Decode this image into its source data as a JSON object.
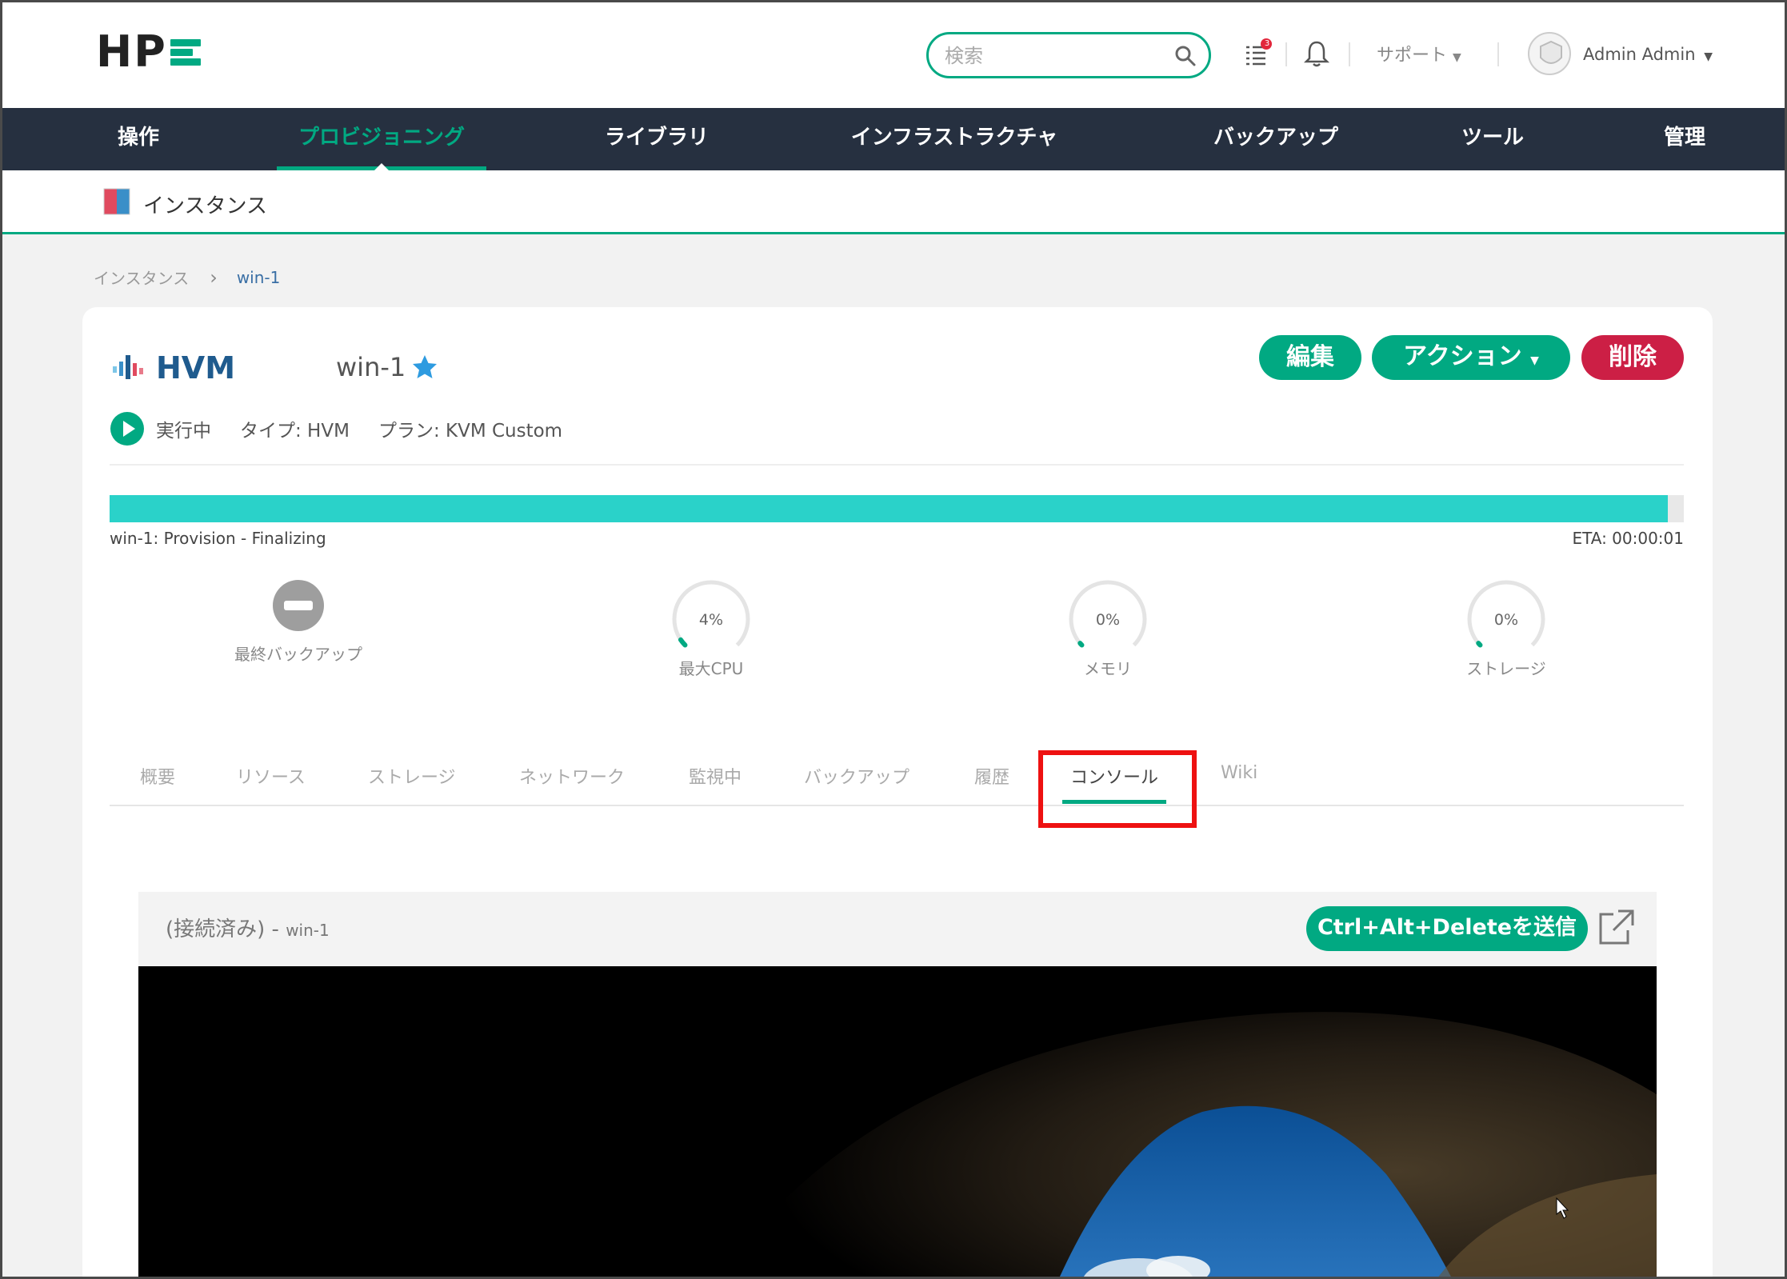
{
  "header": {
    "logo_text": "HP",
    "search_placeholder": "検索",
    "notification_count": "3",
    "support_label": "サポート",
    "user_name": "Admin Admin"
  },
  "nav": {
    "items": [
      {
        "label": "操作"
      },
      {
        "label": "プロビジョニング"
      },
      {
        "label": "ライブラリ"
      },
      {
        "label": "インフラストラクチャ"
      },
      {
        "label": "バックアップ"
      },
      {
        "label": "ツール"
      },
      {
        "label": "管理"
      }
    ],
    "active_index": 1
  },
  "subheader": {
    "title": "インスタンス"
  },
  "breadcrumb": {
    "parent": "インスタンス",
    "current": "win-1"
  },
  "instance": {
    "cloud_logo_text": "HVM",
    "name": "win-1",
    "status_label": "実行中",
    "type_label": "タイプ: HVM",
    "plan_label": "プラン: KVM Custom",
    "buttons": {
      "edit": "編集",
      "actions": "アクション",
      "delete": "削除"
    }
  },
  "progress": {
    "label": "win-1: Provision - Finalizing",
    "eta": "ETA: 00:00:01",
    "fraction": 0.99
  },
  "stats": [
    {
      "label": "最終バックアップ",
      "kind": "none"
    },
    {
      "label": "最大CPU",
      "value_text": "4%",
      "value": 4
    },
    {
      "label": "メモリ",
      "value_text": "0%",
      "value": 0
    },
    {
      "label": "ストレージ",
      "value_text": "0%",
      "value": 0
    }
  ],
  "tabs": [
    {
      "label": "概要"
    },
    {
      "label": "リソース"
    },
    {
      "label": "ストレージ"
    },
    {
      "label": "ネットワーク"
    },
    {
      "label": "監視中"
    },
    {
      "label": "バックアップ"
    },
    {
      "label": "履歴"
    },
    {
      "label": "コンソール"
    },
    {
      "label": "Wiki"
    }
  ],
  "active_tab": "コンソール",
  "console": {
    "title_prefix": "(接続済み) - ",
    "title_host": "win-1",
    "send_cad_label": "Ctrl+Alt+Deleteを送信"
  },
  "colors": {
    "accent": "#01a982",
    "nav_bg": "#263040",
    "danger": "#cc1f45",
    "progress": "#2ad2c9",
    "highlight": "#ee1111"
  }
}
